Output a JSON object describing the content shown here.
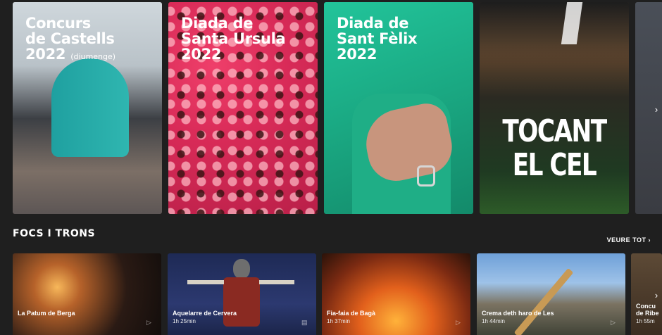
{
  "top_row": {
    "posters": [
      {
        "title": "Concurs\nde Castells\n2022",
        "subtitle": "(diumenge)"
      },
      {
        "title": "Diada de\nSanta Ursula\n2022"
      },
      {
        "title": "Diada de\nSant Fèlix\n2022"
      },
      {
        "title": "TOCANT\nEL CEL"
      }
    ],
    "next_icon": "chevron-right-icon",
    "next_glyph": "›"
  },
  "section": {
    "title": "FOCS I TRONS",
    "see_all": "VEURE TOT",
    "see_all_glyph": "›",
    "next_glyph": "›",
    "cards": [
      {
        "title": "La Patum de Berga",
        "duration": "",
        "icon": "play-icon",
        "glyph": "▷"
      },
      {
        "title": "Aquelarre de Cervera",
        "duration": "1h 25min",
        "icon": "bookmark-icon",
        "glyph": "▤"
      },
      {
        "title": "Fia-faia de Bagà",
        "duration": "1h 37min",
        "icon": "play-icon",
        "glyph": "▷"
      },
      {
        "title": "Crema deth haro de Les",
        "duration": "1h 44min",
        "icon": "play-icon",
        "glyph": "▷"
      },
      {
        "title": "Concu\nde Ribe",
        "duration": "1h 55m",
        "icon": "",
        "glyph": ""
      }
    ]
  }
}
